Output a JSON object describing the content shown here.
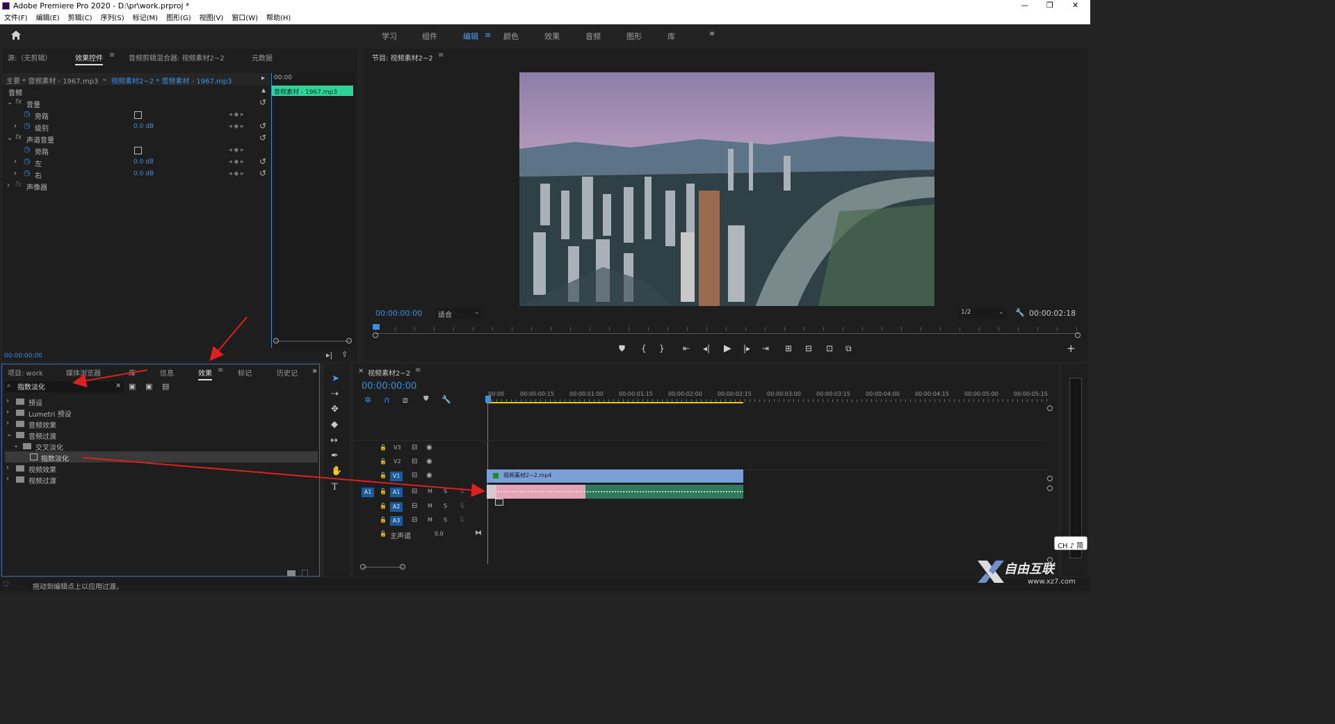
{
  "app": {
    "title": "Adobe Premiere Pro 2020 - D:\\pr\\work.prproj *",
    "window_controls": [
      "—",
      "❐",
      "✕"
    ]
  },
  "menu": [
    "文件(F)",
    "编辑(E)",
    "剪辑(C)",
    "序列(S)",
    "标记(M)",
    "图形(G)",
    "视图(V)",
    "窗口(W)",
    "帮助(H)"
  ],
  "workspace_tabs": [
    "学习",
    "组件",
    "编辑",
    "颜色",
    "效果",
    "音频",
    "图形",
    "库"
  ],
  "workspace_active": "编辑",
  "effect_controls": {
    "tabs": [
      "源:（无剪辑）",
      "效果控件",
      "音频剪辑混合器: 视频素材2~2",
      "元数据"
    ],
    "master_label": "主要 * 音频素材 - 1967.mp3",
    "clip_label": "视频素材2~2 * 音频素材 - 1967.mp3",
    "mini_time": "00:00",
    "mini_clip": "音频素材 - 1967.mp3",
    "section": "音频",
    "rows": [
      {
        "label": "音量",
        "type": "fx"
      },
      {
        "label": "旁路",
        "type": "param"
      },
      {
        "label": "级别",
        "type": "param",
        "value": "0.0 dB"
      },
      {
        "label": "声道音量",
        "type": "fx"
      },
      {
        "label": "旁路",
        "type": "param"
      },
      {
        "label": "左",
        "type": "param",
        "value": "0.0 dB"
      },
      {
        "label": "右",
        "type": "param",
        "value": "0.0 dB"
      },
      {
        "label": "声像器",
        "type": "fx"
      }
    ],
    "timecode": "00:00:00:00"
  },
  "program": {
    "title": "节目: 视频素材2~2",
    "timecode": "00:00:00:00",
    "fit": "适合",
    "resolution": "1/2",
    "duration": "00:00:02:18"
  },
  "project": {
    "tabs": [
      "项目: work",
      "媒体浏览器",
      "库",
      "信息",
      "效果",
      "标记",
      "历史记"
    ],
    "active_tab": "效果",
    "search_value": "指数淡化",
    "tree": [
      {
        "label": "预设",
        "indent": 0,
        "type": "folder"
      },
      {
        "label": "Lumetri 预设",
        "indent": 0,
        "type": "folder"
      },
      {
        "label": "音频效果",
        "indent": 0,
        "type": "folder"
      },
      {
        "label": "音频过渡",
        "indent": 0,
        "type": "folder",
        "open": true
      },
      {
        "label": "交叉淡化",
        "indent": 1,
        "type": "folder",
        "open": true
      },
      {
        "label": "指数淡化",
        "indent": 2,
        "type": "effect",
        "selected": true
      },
      {
        "label": "视频效果",
        "indent": 0,
        "type": "folder"
      },
      {
        "label": "视频过渡",
        "indent": 0,
        "type": "folder"
      }
    ]
  },
  "timeline": {
    "title": "视频素材2~2",
    "timecode": "00:00:00:00",
    "ruler": [
      "00:00",
      "00:00:00:15",
      "00:00:01:00",
      "00:00:01:15",
      "00:00:02:00",
      "00:00:02:15",
      "00:00:03:00",
      "00:00:03:15",
      "00:00:04:00",
      "00:00:04:15",
      "00:00:05:00",
      "00:00:05:15"
    ],
    "tracks": [
      {
        "name": "V3",
        "kind": "video"
      },
      {
        "name": "V2",
        "kind": "video"
      },
      {
        "name": "V1",
        "kind": "video",
        "target": true
      },
      {
        "name": "A1",
        "kind": "audio",
        "target": true,
        "source": "A1"
      },
      {
        "name": "A2",
        "kind": "audio"
      },
      {
        "name": "A3",
        "kind": "audio"
      }
    ],
    "master_label": "主声道",
    "master_value": "0.0",
    "video_clip": "视频素材2~2.mp4",
    "mute": "M",
    "solo": "S"
  },
  "status": "拖动到编辑点上以应用过渡。",
  "ime": "CH ♪ 简",
  "watermark": {
    "brand": "自由互联",
    "url": "www.xz7.com"
  },
  "colors": {
    "accent": "#3c8fe0",
    "clip_green": "#2fd39a",
    "video_clip": "#7a9ed6",
    "audio_pink": "#e6a3b8",
    "audio_green": "#2f7a5d",
    "arrow": "#e02020"
  }
}
